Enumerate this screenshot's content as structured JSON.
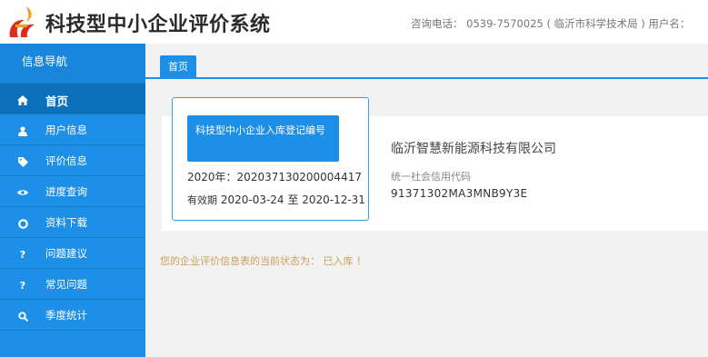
{
  "header": {
    "title": "科技型中小企业评价系统",
    "info": "咨询电话： 0539-7570025 ( 临沂市科学技术局 ) 用户名："
  },
  "sidebar": {
    "heading": "信息导航",
    "items": [
      {
        "label": "首页",
        "icon": "home-icon",
        "active": true
      },
      {
        "label": "用户信息",
        "icon": "user-icon"
      },
      {
        "label": "评价信息",
        "icon": "tag-icon"
      },
      {
        "label": "进度查询",
        "icon": "eye-icon"
      },
      {
        "label": "资料下载",
        "icon": "circle-icon"
      },
      {
        "label": "问题建议",
        "icon": "question-icon"
      },
      {
        "label": "常见问题",
        "icon": "question-icon"
      },
      {
        "label": "季度统计",
        "icon": "search-icon"
      }
    ]
  },
  "tabs": [
    {
      "label": "首页"
    }
  ],
  "registration": {
    "button_label": "科技型中小企业入库登记编号",
    "year_label": "2020年：",
    "number": "202037130200004417",
    "validity_label": "有效期",
    "validity_range": "2020-03-24 至 2020-12-31"
  },
  "company": {
    "name": "临沂智慧新能源科技有限公司",
    "credit_code_label": "统一社会信用代码",
    "credit_code": "91371302MA3MNB9Y3E"
  },
  "status": {
    "text": "您的企业评价信息表的当前状态为： 已入库 ！"
  },
  "colors": {
    "primary": "#1e8fe6",
    "active": "#0d6fba",
    "status_text": "#c8a25a",
    "logo_red": "#e02a1c",
    "logo_orange": "#f4a01c"
  }
}
